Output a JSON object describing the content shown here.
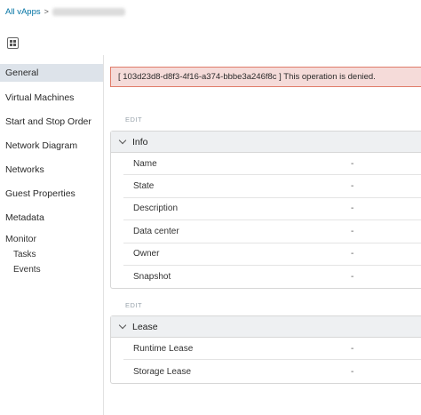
{
  "breadcrumb": {
    "root_label": "All vApps",
    "separator": ">"
  },
  "alert": {
    "message": "[ 103d23d8-d8f3-4f16-a374-bbbe3a246f8c ] This operation is denied."
  },
  "sidebar": {
    "items": [
      {
        "label": "General",
        "active": true
      },
      {
        "label": "Virtual Machines"
      },
      {
        "label": "Start and Stop Order"
      },
      {
        "label": "Network Diagram"
      },
      {
        "label": "Networks"
      },
      {
        "label": "Guest Properties"
      },
      {
        "label": "Metadata"
      }
    ],
    "monitor": {
      "label": "Monitor",
      "items": [
        {
          "label": "Tasks"
        },
        {
          "label": "Events"
        }
      ]
    }
  },
  "info_section": {
    "edit_label": "EDIT",
    "title": "Info",
    "rows": [
      {
        "label": "Name",
        "value": "-"
      },
      {
        "label": "State",
        "value": "-"
      },
      {
        "label": "Description",
        "value": "-"
      },
      {
        "label": "Data center",
        "value": "-"
      },
      {
        "label": "Owner",
        "value": "-"
      },
      {
        "label": "Snapshot",
        "value": "-"
      }
    ]
  },
  "lease_section": {
    "edit_label": "EDIT",
    "title": "Lease",
    "rows": [
      {
        "label": "Runtime Lease",
        "value": "-"
      },
      {
        "label": "Storage Lease",
        "value": "-"
      }
    ]
  },
  "colors": {
    "link": "#0072a3",
    "alert_bg": "#f5dbd9",
    "alert_border": "#e07c6a",
    "nav_active_bg": "#dde3ea"
  },
  "icons": {
    "app_switcher": "grid-icon",
    "chevron": "chevron-down-icon"
  }
}
